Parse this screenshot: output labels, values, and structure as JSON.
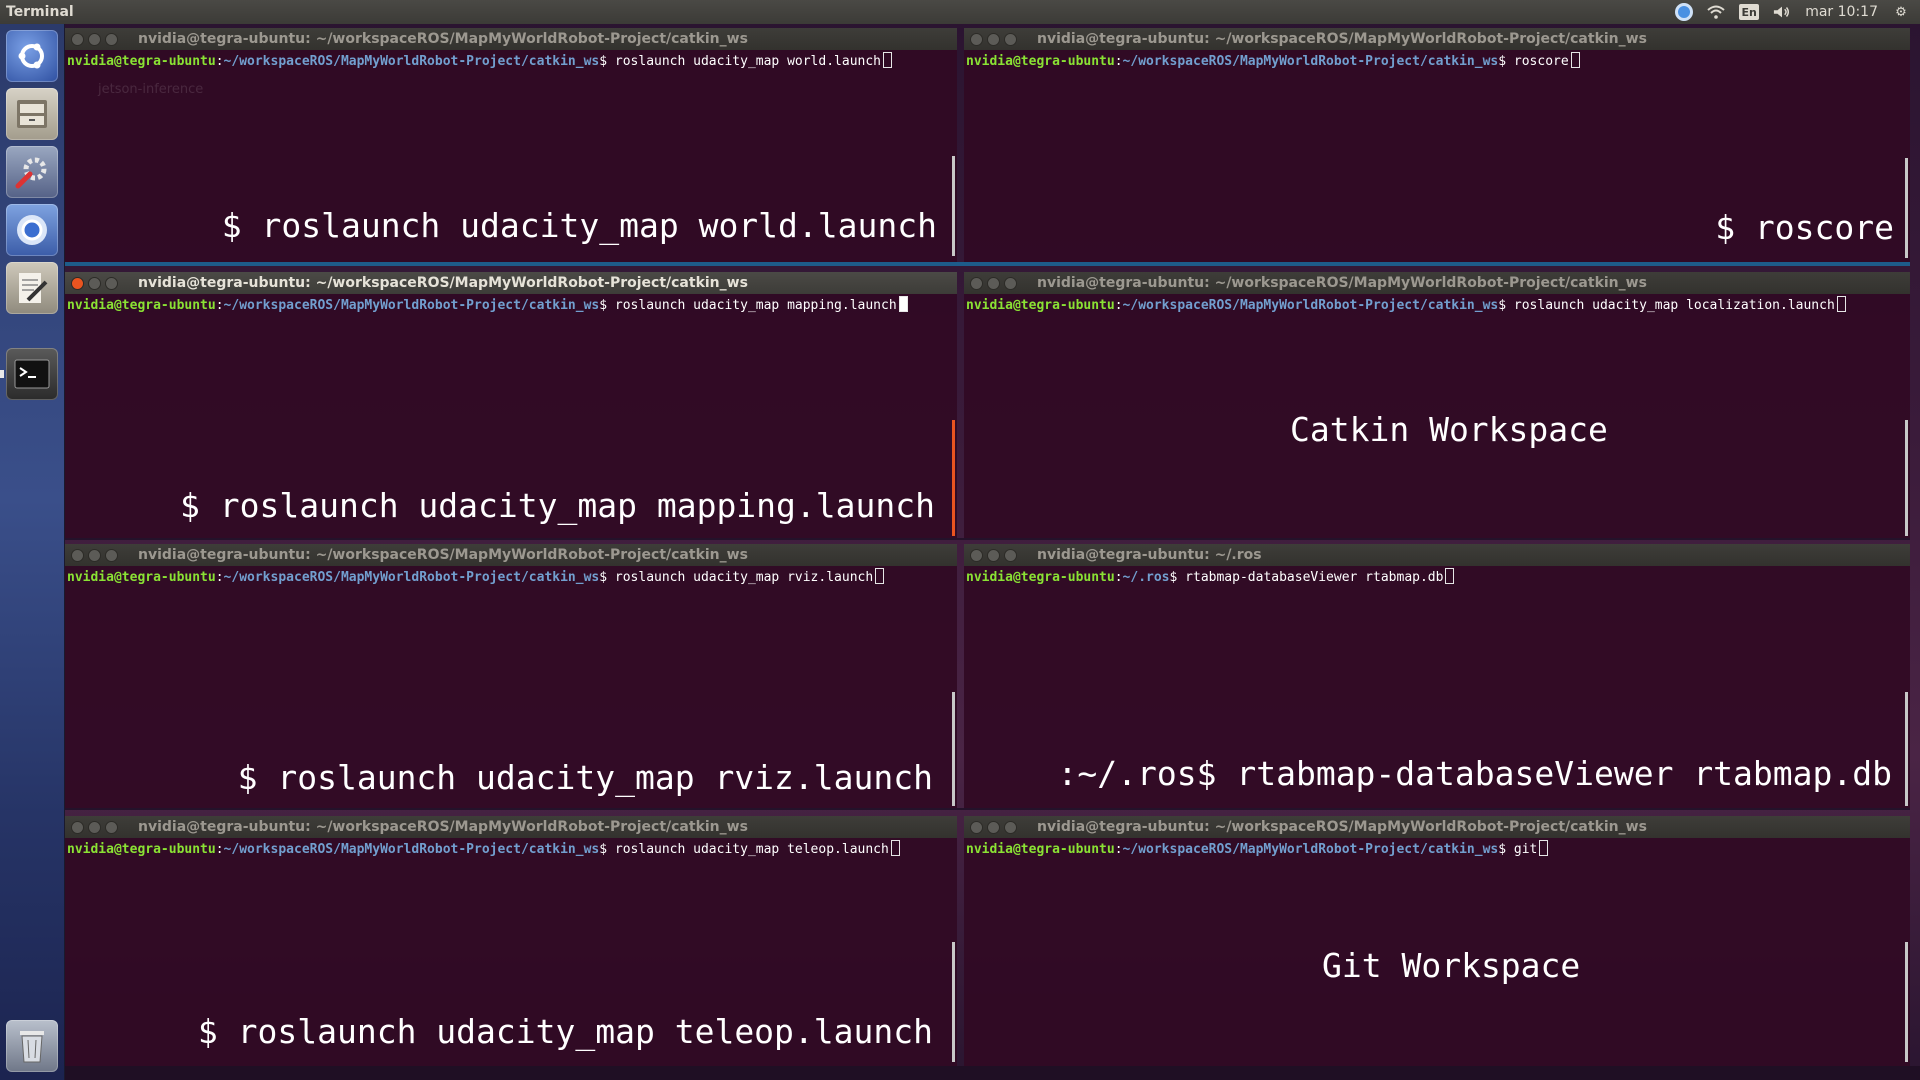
{
  "topbar": {
    "app_title": "Terminal",
    "language": "En",
    "clock": "mar 10:17"
  },
  "launcher": {
    "items": [
      "ubuntu-dash",
      "files",
      "system-settings",
      "chromium",
      "text-editor",
      "terminal",
      "trash"
    ]
  },
  "panes": [
    {
      "title": "nvidia@tegra-ubuntu: ~/workspaceROS/MapMyWorldRobot-Project/catkin_ws",
      "user": "nvidia@tegra-ubuntu",
      "path": "~/workspaceROS/MapMyWorldRobot-Project/catkin_ws",
      "command": "roslaunch udacity_map world.launch",
      "label": "$ roslaunch udacity_map world.launch",
      "faint": "jetson-inference"
    },
    {
      "title": "nvidia@tegra-ubuntu: ~/workspaceROS/MapMyWorldRobot-Project/catkin_ws",
      "user": "nvidia@tegra-ubuntu",
      "path": "~/workspaceROS/MapMyWorldRobot-Project/catkin_ws",
      "command": "roscore",
      "label": "$ roscore"
    },
    {
      "title": "nvidia@tegra-ubuntu: ~/workspaceROS/MapMyWorldRobot-Project/catkin_ws",
      "user": "nvidia@tegra-ubuntu",
      "path": "~/workspaceROS/MapMyWorldRobot-Project/catkin_ws",
      "command": "roslaunch udacity_map mapping.launch",
      "label": "$ roslaunch udacity_map mapping.launch"
    },
    {
      "title": "nvidia@tegra-ubuntu: ~/workspaceROS/MapMyWorldRobot-Project/catkin_ws",
      "user": "nvidia@tegra-ubuntu",
      "path": "~/workspaceROS/MapMyWorldRobot-Project/catkin_ws",
      "command": "roslaunch udacity_map localization.launch",
      "label": "Catkin Workspace"
    },
    {
      "title": "nvidia@tegra-ubuntu: ~/workspaceROS/MapMyWorldRobot-Project/catkin_ws",
      "user": "nvidia@tegra-ubuntu",
      "path": "~/workspaceROS/MapMyWorldRobot-Project/catkin_ws",
      "command": "roslaunch udacity_map rviz.launch",
      "label": "$ roslaunch udacity_map rviz.launch"
    },
    {
      "title": "nvidia@tegra-ubuntu: ~/.ros",
      "user": "nvidia@tegra-ubuntu",
      "path": "~/.ros",
      "command": "rtabmap-databaseViewer rtabmap.db",
      "label": ":~/.ros$ rtabmap-databaseViewer rtabmap.db"
    },
    {
      "title": "nvidia@tegra-ubuntu: ~/workspaceROS/MapMyWorldRobot-Project/catkin_ws",
      "user": "nvidia@tegra-ubuntu",
      "path": "~/workspaceROS/MapMyWorldRobot-Project/catkin_ws",
      "command": "roslaunch udacity_map teleop.launch",
      "label": "$ roslaunch udacity_map teleop.launch"
    },
    {
      "title": "nvidia@tegra-ubuntu: ~/workspaceROS/MapMyWorldRobot-Project/catkin_ws",
      "user": "nvidia@tegra-ubuntu",
      "path": "~/workspaceROS/MapMyWorldRobot-Project/catkin_ws",
      "command": "git",
      "label": "Git Workspace"
    }
  ]
}
